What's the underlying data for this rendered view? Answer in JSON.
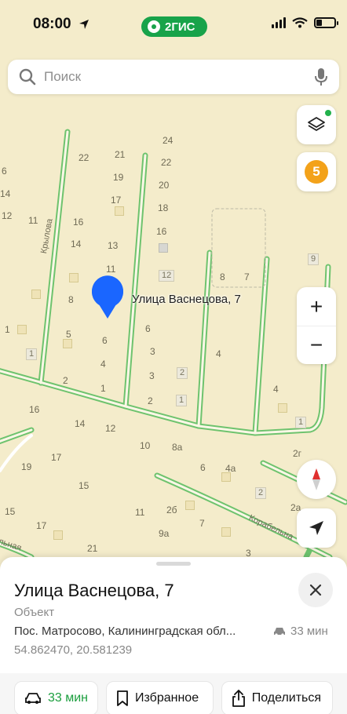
{
  "status_bar": {
    "time": "08:00",
    "brand": "2ГИС"
  },
  "search": {
    "placeholder": "Поиск"
  },
  "map": {
    "traffic_score": "5",
    "marker_label": "Улица Васнецова, 7",
    "street_labels": [
      "Крылова",
      "Корабельна",
      "льная"
    ],
    "house_numbers": [
      "24",
      "22",
      "21",
      "22",
      "19",
      "20",
      "17",
      "18",
      "11",
      "16",
      "16",
      "14",
      "13",
      "11",
      "12",
      "8",
      "7",
      "8",
      "6",
      "5",
      "6",
      "3",
      "4",
      "3",
      "2",
      "1",
      "2",
      "1",
      "4",
      "16",
      "14",
      "12",
      "10",
      "8а",
      "19",
      "17",
      "6",
      "4а",
      "15",
      "2",
      "2а",
      "15",
      "11",
      "2б",
      "7",
      "17",
      "9а",
      "21",
      "3",
      "6",
      "14",
      "12",
      "9",
      "1",
      "2г"
    ],
    "map_boxes": [
      "12",
      "9",
      "1",
      "2"
    ]
  },
  "controls": {
    "zoom_in": "+",
    "zoom_out": "−"
  },
  "sheet": {
    "title": "Улица Васнецова, 7",
    "type": "Объект",
    "address": "Пос. Матросово, Калининградская обл...",
    "eta": "33 мин",
    "coords": "54.862470, 20.581239",
    "actions": {
      "route": "33 мин",
      "favorite": "Избранное",
      "share": "Поделиться"
    }
  }
}
